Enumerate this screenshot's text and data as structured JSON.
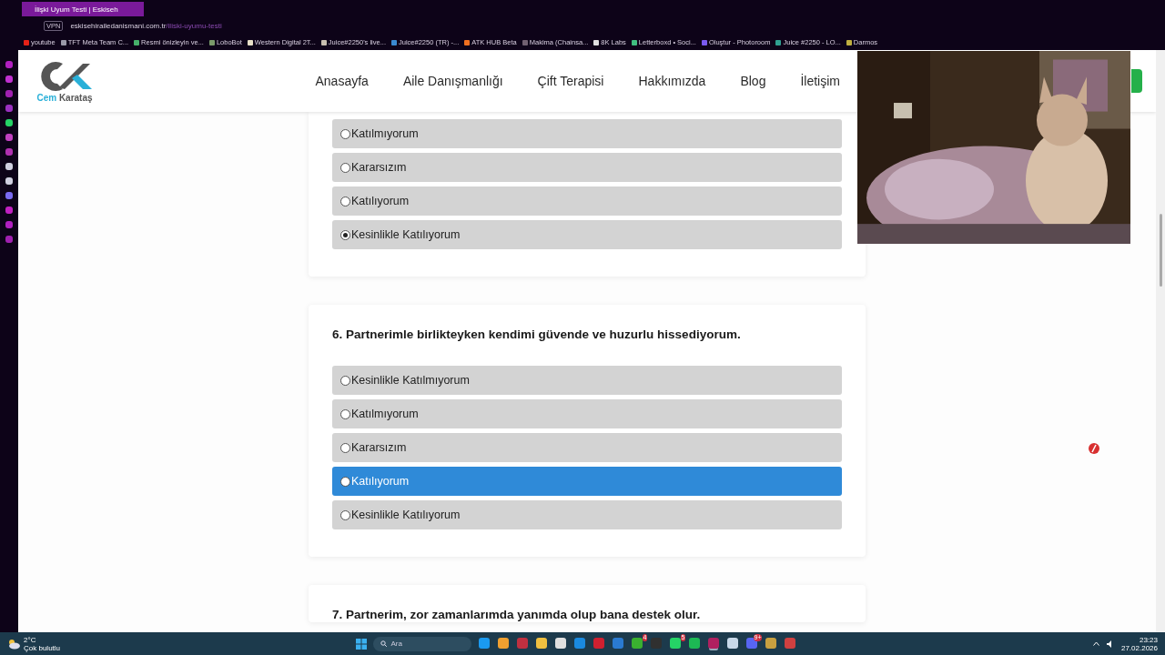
{
  "browser": {
    "tabs": [
      {
        "title": "İlişki Uyum Testi | Eskiseh",
        "selected": true
      }
    ],
    "url": {
      "host": "eskisehirailedanismani.com.tr",
      "path": "/iliski-uyumu-testi"
    },
    "vpn": "VPN",
    "bookmarks": [
      {
        "label": "youtube",
        "color": "#e62117"
      },
      {
        "label": "TFT Meta Team C...",
        "color": "#9a9aa8"
      },
      {
        "label": "Resmi önizleyin ve...",
        "color": "#46b06a"
      },
      {
        "label": "LoboBot",
        "color": "#7a9a6a"
      },
      {
        "label": "Western Digital 2T...",
        "color": "#e8e0c8"
      },
      {
        "label": "Juice#2250's live...",
        "color": "#c8c0b0"
      },
      {
        "label": "Juice#2250 (TR) -...",
        "color": "#3a8ad0"
      },
      {
        "label": "ATK HUB Beta",
        "color": "#f07020"
      },
      {
        "label": "Makima (Chainsa...",
        "color": "#706070"
      },
      {
        "label": "8K Labs",
        "color": "#e0e0e0"
      },
      {
        "label": "Letterboxd • Soci...",
        "color": "#40c080"
      },
      {
        "label": "Oluştur - Photoroom",
        "color": "#7a5af0"
      },
      {
        "label": "Juice #2250 - LO...",
        "color": "#30a090"
      },
      {
        "label": "Darmos",
        "color": "#c0b040"
      }
    ]
  },
  "side_panel": [
    {
      "color": "#b020c0"
    },
    {
      "color": "#c030d0"
    },
    {
      "color": "#a020b0"
    },
    {
      "color": "#9a30c0"
    },
    {
      "color": "#25d366"
    },
    {
      "color": "#c040c0"
    },
    {
      "color": "#b030b0"
    },
    {
      "color": "#d0d0e0"
    },
    {
      "color": "#d0d0e0"
    },
    {
      "color": "#7a6af0"
    },
    {
      "color": "#c020c0"
    },
    {
      "color": "#b020c0"
    },
    {
      "color": "#a020b0"
    }
  ],
  "site": {
    "logo_text": {
      "first": "Cem",
      "last": "Karataş"
    },
    "nav": [
      "Anasayfa",
      "Aile Danışmanlığı",
      "Çift Terapisi",
      "Hakkımızda",
      "Blog",
      "İletişim"
    ],
    "questions": [
      {
        "options": [
          {
            "label": "Katılmıyorum",
            "selected": false,
            "hovered": false
          },
          {
            "label": "Kararsızım",
            "selected": false,
            "hovered": false
          },
          {
            "label": "Katılıyorum",
            "selected": false,
            "hovered": false
          },
          {
            "label": "Kesinlikle Katılıyorum",
            "selected": true,
            "hovered": false
          }
        ]
      },
      {
        "title": "6. Partnerimle birlikteyken kendimi güvende ve huzurlu hissediyorum.",
        "options": [
          {
            "label": "Kesinlikle Katılmıyorum",
            "selected": false,
            "hovered": false
          },
          {
            "label": "Katılmıyorum",
            "selected": false,
            "hovered": false
          },
          {
            "label": "Kararsızım",
            "selected": false,
            "hovered": false
          },
          {
            "label": "Katılıyorum",
            "selected": false,
            "hovered": true
          },
          {
            "label": "Kesinlikle Katılıyorum",
            "selected": false,
            "hovered": false
          }
        ]
      },
      {
        "title": "7. Partnerim, zor zamanlarımda yanımda olup bana destek olur."
      }
    ]
  },
  "taskbar": {
    "weather": {
      "temp": "2°C",
      "text": "Çok bulutlu"
    },
    "search": {
      "placeholder": "Ara"
    },
    "apps": [
      {
        "color": "#1a9af0",
        "active": false
      },
      {
        "color": "#f0a030",
        "active": false
      },
      {
        "color": "#c03040",
        "active": false
      },
      {
        "color": "#f0c040",
        "active": false
      },
      {
        "color": "#e0e0e0",
        "active": false
      },
      {
        "color": "#1a8ae0",
        "active": false
      },
      {
        "color": "#d02030",
        "active": false
      },
      {
        "color": "#2a7ad0",
        "active": false
      },
      {
        "color": "#3ab030",
        "badge": "4",
        "active": false
      },
      {
        "color": "#303030",
        "active": false
      },
      {
        "color": "#25d366",
        "badge": "5",
        "active": false
      },
      {
        "color": "#1db954",
        "active": false
      },
      {
        "color": "#b02060",
        "active": true
      },
      {
        "color": "#c8d8e8",
        "active": false
      },
      {
        "color": "#5865f2",
        "badge": "9+",
        "active": false
      },
      {
        "color": "#c8a040",
        "active": false
      },
      {
        "color": "#d04040",
        "active": false
      }
    ],
    "time": "23:23",
    "date": "27.02.2026"
  }
}
